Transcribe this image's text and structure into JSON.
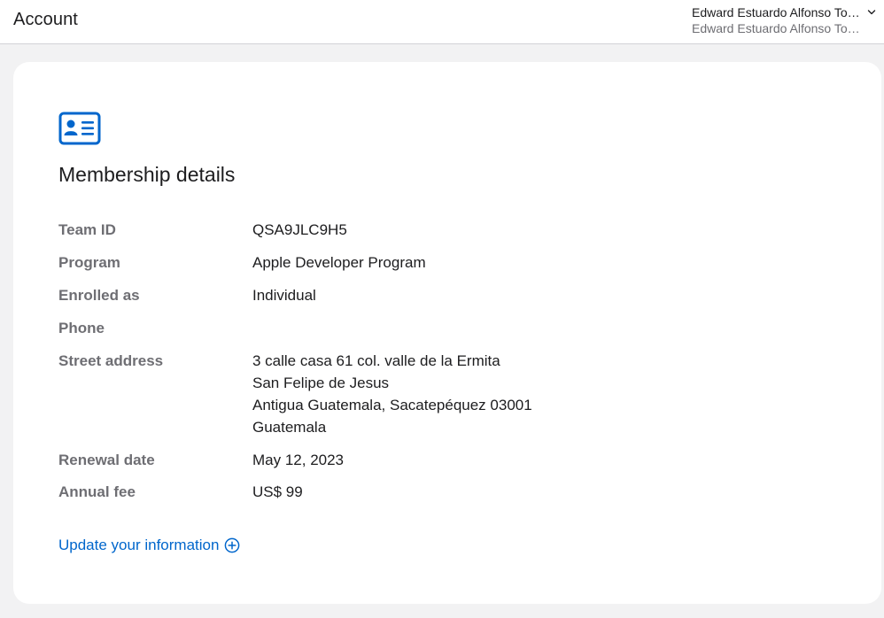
{
  "header": {
    "title": "Account",
    "account_name": "Edward Estuardo Alfonso Torres",
    "account_subtitle": "Edward Estuardo Alfonso Torres"
  },
  "membership": {
    "icon": "id-card-icon",
    "title": "Membership details",
    "rows": {
      "team_id": {
        "label": "Team ID",
        "value": "QSA9JLC9H5"
      },
      "program": {
        "label": "Program",
        "value": "Apple Developer Program"
      },
      "enrolled_as": {
        "label": "Enrolled as",
        "value": "Individual"
      },
      "phone": {
        "label": "Phone",
        "value": ""
      },
      "street_address": {
        "label": "Street address",
        "lines": [
          "3 calle casa 61 col. valle de la Ermita",
          "San Felipe de Jesus",
          "Antigua Guatemala, Sacatepéquez 03001",
          "Guatemala"
        ]
      },
      "renewal_date": {
        "label": "Renewal date",
        "value": "May 12, 2023"
      },
      "annual_fee": {
        "label": "Annual fee",
        "value": "US$ 99"
      }
    },
    "update_link": "Update your information"
  },
  "colors": {
    "accent": "#0066cc",
    "label_gray": "#6e6e73",
    "background": "#f2f2f3"
  }
}
